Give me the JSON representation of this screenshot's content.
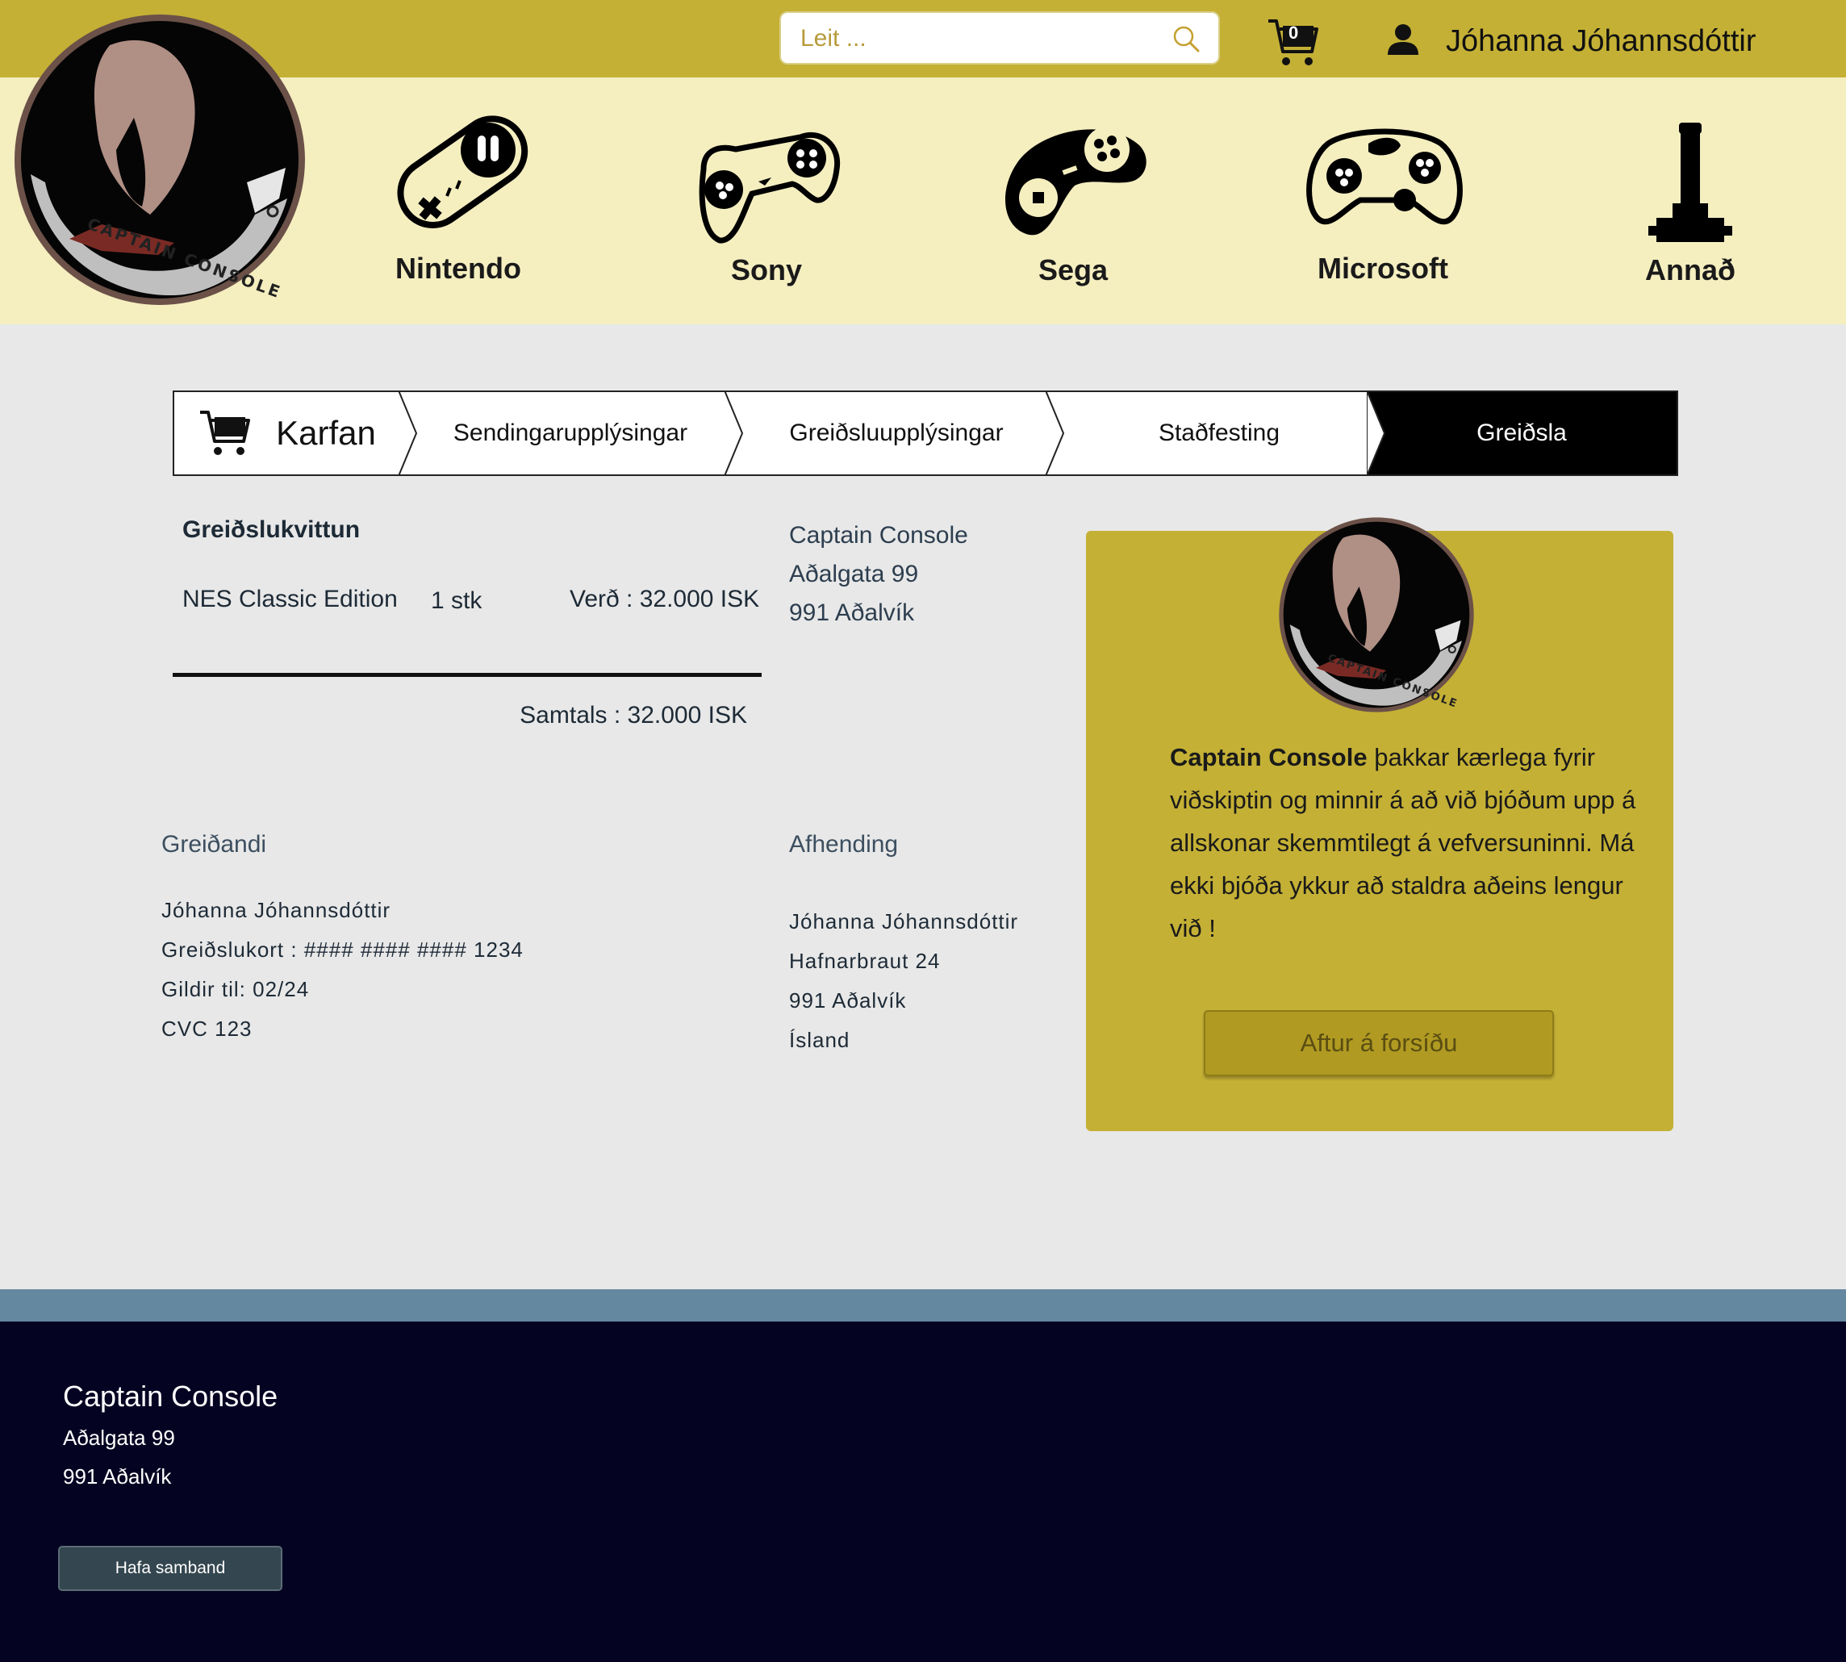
{
  "header": {
    "search_placeholder": "Leit ...",
    "cart_count": "0",
    "user_name": "Jóhanna Jóhannsdóttir",
    "logo_text": "CAPTAIN CONSOLE"
  },
  "nav": {
    "items": [
      {
        "label": "Nintendo",
        "icon": "snes-controller-icon"
      },
      {
        "label": "Sony",
        "icon": "playstation-controller-icon"
      },
      {
        "label": "Sega",
        "icon": "sega-controller-icon"
      },
      {
        "label": "Microsoft",
        "icon": "xbox-controller-icon"
      },
      {
        "label": "Annað",
        "icon": "joystick-icon"
      }
    ]
  },
  "steps": {
    "items": [
      "Karfan",
      "Sendingarupplýsingar",
      "Greiðsluupplýsingar",
      "Staðfesting",
      "Greiðsla"
    ],
    "active_index": 4
  },
  "receipt": {
    "title": "Greiðslukvittun",
    "line": {
      "product": "NES Classic Edition",
      "qty": "1 stk",
      "price": "Verð : 32.000 ISK"
    },
    "total": "Samtals : 32.000 ISK"
  },
  "shop": {
    "name": "Captain Console",
    "street": "Aðalgata 99",
    "city": "991 Aðalvík"
  },
  "payer": {
    "heading": "Greiðandi",
    "name": "Jóhanna Jóhannsdóttir",
    "card": "Greiðslukort : #### #### #### 1234",
    "expiry": "Gildir til: 02/24",
    "cvc": "CVC 123"
  },
  "delivery": {
    "heading": "Afhending",
    "name": "Jóhanna Jóhannsdóttir",
    "street": "Hafnarbraut 24",
    "city": "991 Aðalvík",
    "country": "Ísland"
  },
  "thanks": {
    "brand": "Captain Console",
    "message": " þakkar kærlega fyrir viðskiptin og minnir á að við bjóðum upp á allskonar skemmtilegt á vefversuninni. Má ekki bjóða ykkur að staldra aðeins lengur við !",
    "button": "Aftur á forsíðu"
  },
  "footer": {
    "name": "Captain Console",
    "street": "Aðalgata 99",
    "city": "991 Aðalvík",
    "contact_button": "Hafa samband"
  },
  "colors": {
    "topbar": "#c4b035",
    "nav_band": "#f5eebf",
    "page_bg": "#e8e8e8",
    "card": "#c4b035",
    "footer": "#050322",
    "footer_stripe": "#6488a0"
  }
}
